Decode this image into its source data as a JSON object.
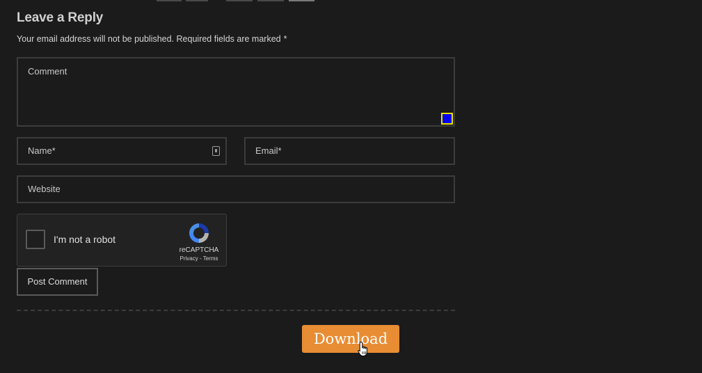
{
  "form": {
    "title": "Leave a Reply",
    "notes": "Your email address will not be published. Required fields are marked",
    "required_mark": "*",
    "comment_placeholder": "Comment",
    "name_placeholder": "Name*",
    "email_placeholder": "Email*",
    "website_placeholder": "Website",
    "submit_label": "Post Comment"
  },
  "recaptcha": {
    "label": "I'm not a robot",
    "brand": "reCAPTCHA",
    "legal": "Privacy - Terms",
    "checked": false
  },
  "download": {
    "label": "Download"
  },
  "colors": {
    "background": "#1b1b1b",
    "download_accent": "#e88d34"
  },
  "icons": {
    "contact_field": "contact-card-icon",
    "resize": "textarea-resize-handle",
    "cursor": "hand-pointer-cursor"
  }
}
